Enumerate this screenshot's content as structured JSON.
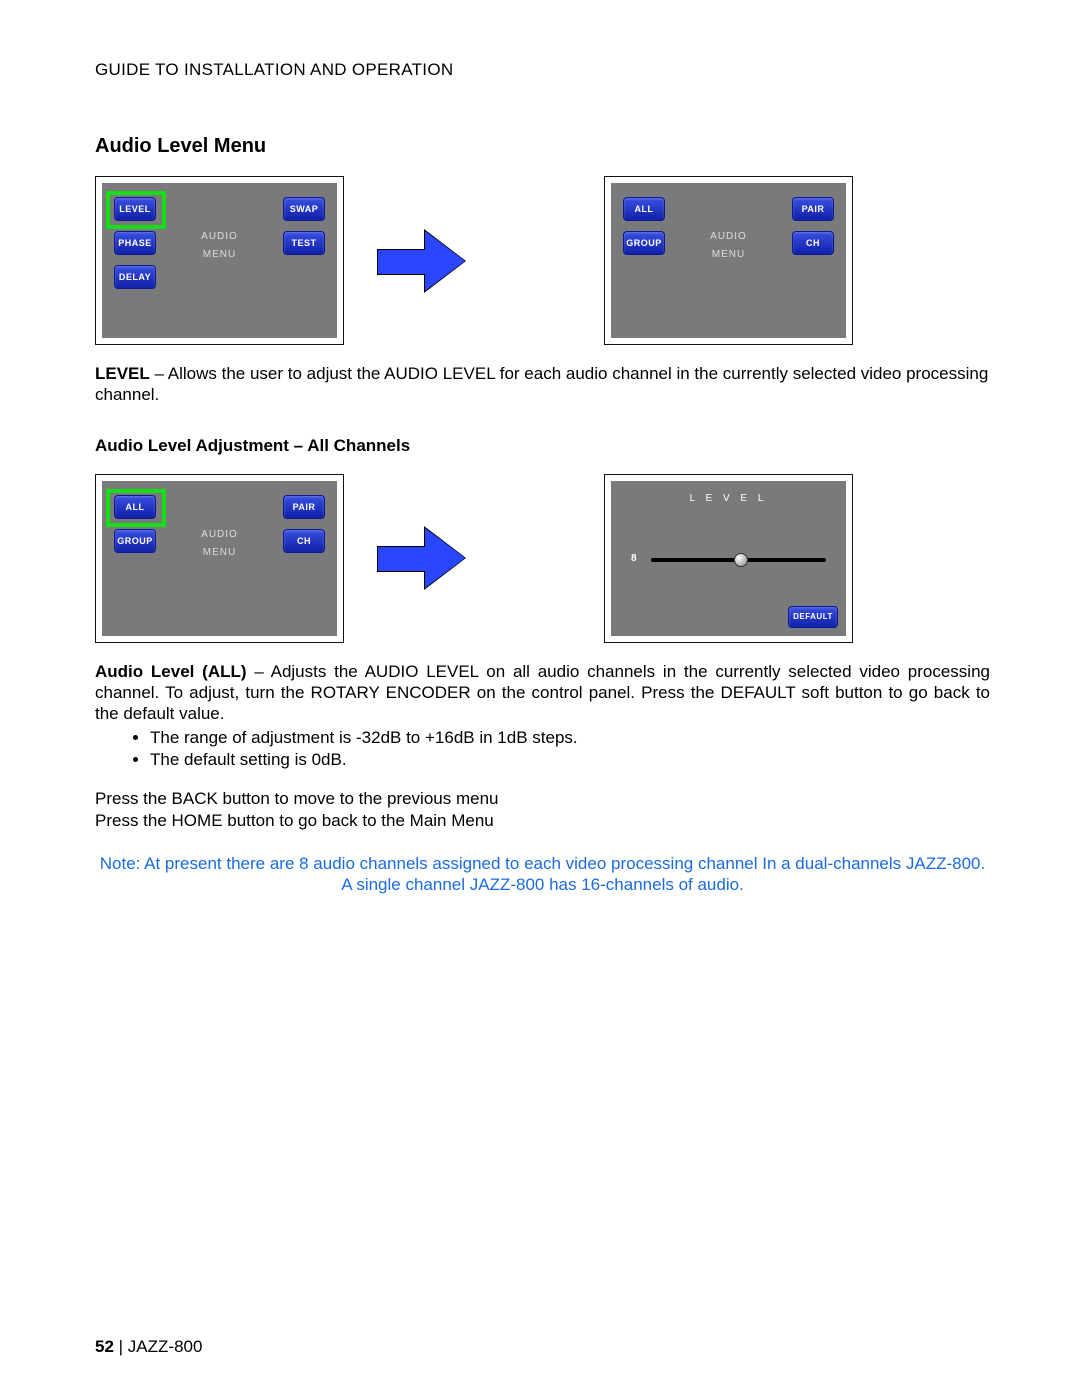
{
  "header": "GUIDE TO INSTALLATION AND OPERATION",
  "sectionTitle": "Audio Level Menu",
  "screen1": {
    "left": [
      "LEVEL",
      "PHASE",
      "DELAY"
    ],
    "right": [
      "SWAP",
      "TEST"
    ],
    "centerTop": "AUDIO",
    "centerBottom": "MENU"
  },
  "screen2": {
    "left": [
      "ALL",
      "GROUP"
    ],
    "right": [
      "PAIR",
      "CH"
    ],
    "centerTop": "AUDIO",
    "centerBottom": "MENU"
  },
  "para1_bold": "LEVEL",
  "para1_rest": " – Allows the user to adjust the AUDIO LEVEL for each audio channel in the currently selected video processing channel.",
  "subTitle": "Audio Level Adjustment – All Channels",
  "slider": {
    "title": "L E V E L",
    "value": "8",
    "defaultBtn": "DEFAULT"
  },
  "para2_bold": "Audio Level (ALL)",
  "para2_rest": " – Adjusts the AUDIO LEVEL on all audio channels in the currently selected video processing channel. To adjust, turn the ROTARY ENCODER on the control panel. Press the DEFAULT soft button to go back to the default value.",
  "bullets": [
    "The range of adjustment is -32dB to +16dB in 1dB steps.",
    "The default setting is 0dB."
  ],
  "para3": "Press the BACK button to move to the previous menu",
  "para4": "Press the HOME button to go back to the Main Menu",
  "note": "Note: At present there are 8 audio channels assigned to each video processing channel In a dual-channels JAZZ-800. A single channel JAZZ-800 has 16-channels of audio.",
  "footer_page": "52",
  "footer_sep": "  |  ",
  "footer_model": "JAZZ-800"
}
